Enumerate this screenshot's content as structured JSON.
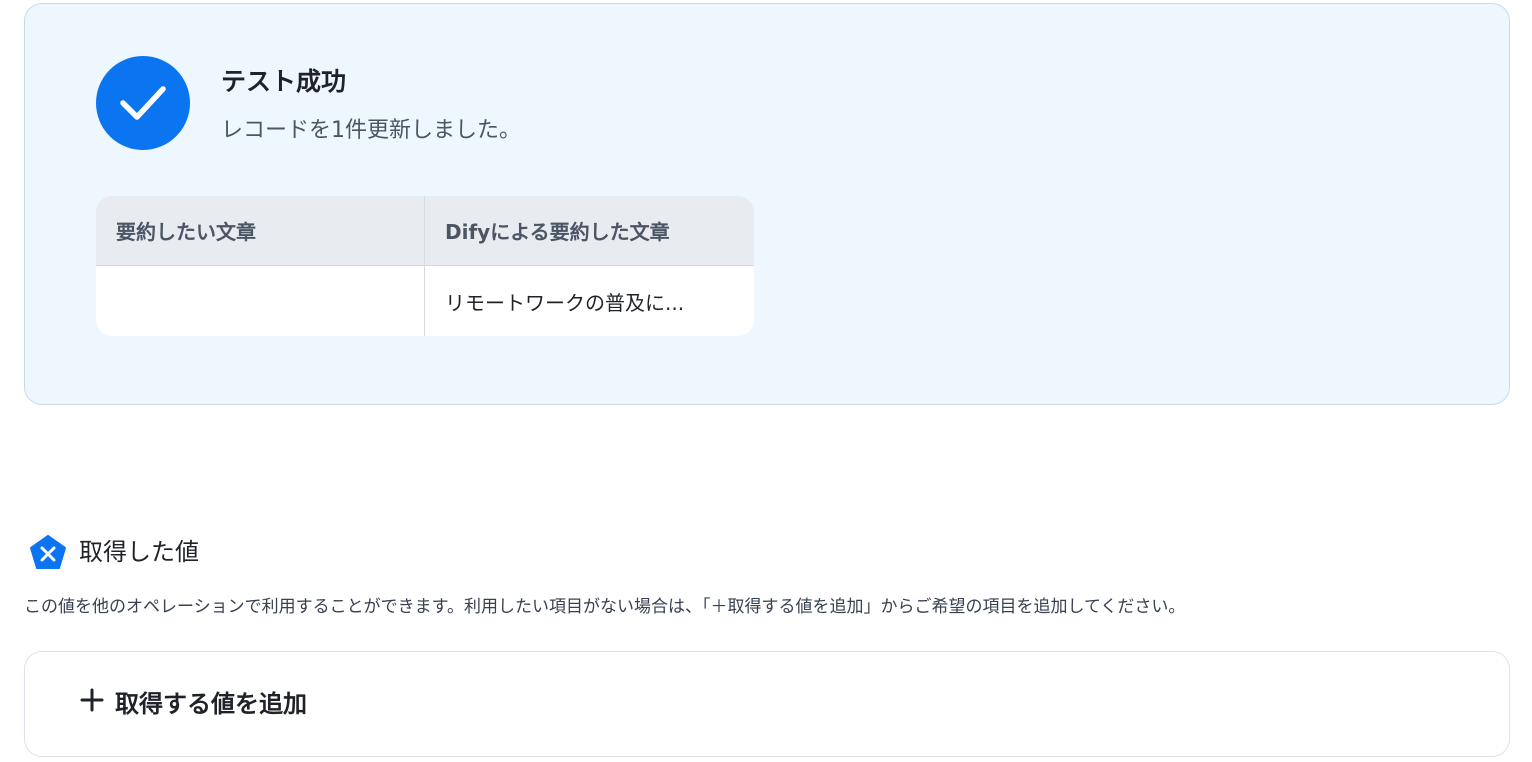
{
  "result": {
    "title": "テスト成功",
    "message": "レコードを1件更新しました。",
    "icon": "check-circle-icon",
    "accent_color": "#0b74f1",
    "table": {
      "headers": [
        "要約したい文章",
        "Difyによる要約した文章"
      ],
      "rows": [
        [
          "",
          "リモートワークの普及に..."
        ]
      ]
    }
  },
  "fetched": {
    "icon": "variable-x-icon",
    "title": "取得した値",
    "description": "この値を他のオペレーションで利用することができます。利用したい項目がない場合は、「＋取得する値を追加」からご希望の項目を追加してください。",
    "add_button_label": "取得する値を追加",
    "add_icon": "plus-icon"
  }
}
